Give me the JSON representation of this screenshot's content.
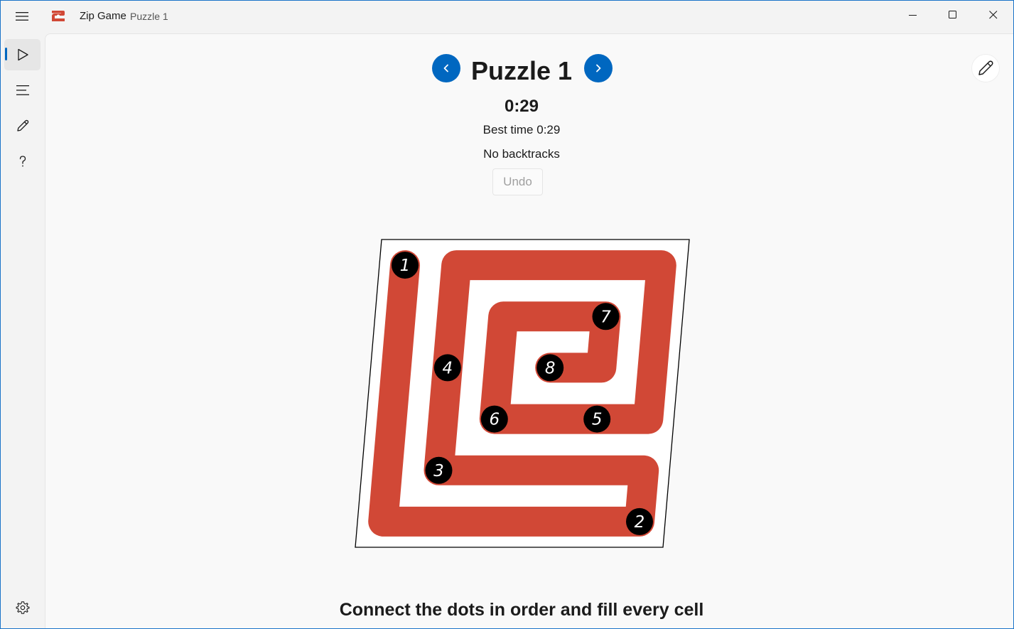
{
  "window": {
    "app_title": "Zip Game",
    "subtitle": "Puzzle 1",
    "controls": [
      "minimize",
      "maximize",
      "close"
    ]
  },
  "sidebar": {
    "items": [
      {
        "icon": "play-icon",
        "active": true
      },
      {
        "icon": "list-icon",
        "active": false
      },
      {
        "icon": "pencil-icon",
        "active": false
      },
      {
        "icon": "help-icon",
        "active": false
      }
    ],
    "footer_icon": "settings-icon"
  },
  "puzzle": {
    "title": "Puzzle 1",
    "timer": "0:29",
    "best_time": "Best time 0:29",
    "backtracks": "No backtracks",
    "undo_label": "Undo",
    "undo_enabled": false
  },
  "board": {
    "rows": 6,
    "cols": 6,
    "path_color": "#d14836",
    "dots": [
      {
        "label": "1",
        "row": 0,
        "col": 0
      },
      {
        "label": "2",
        "row": 5,
        "col": 5
      },
      {
        "label": "3",
        "row": 4,
        "col": 1
      },
      {
        "label": "4",
        "row": 2,
        "col": 1
      },
      {
        "label": "5",
        "row": 3,
        "col": 4
      },
      {
        "label": "6",
        "row": 3,
        "col": 2
      },
      {
        "label": "7",
        "row": 1,
        "col": 4
      },
      {
        "label": "8",
        "row": 2,
        "col": 3
      }
    ],
    "path": [
      [
        0,
        0
      ],
      [
        1,
        0
      ],
      [
        2,
        0
      ],
      [
        3,
        0
      ],
      [
        4,
        0
      ],
      [
        5,
        0
      ],
      [
        5,
        1
      ],
      [
        5,
        2
      ],
      [
        5,
        3
      ],
      [
        5,
        4
      ],
      [
        5,
        5
      ],
      [
        4,
        5
      ],
      [
        4,
        4
      ],
      [
        4,
        3
      ],
      [
        4,
        2
      ],
      [
        4,
        1
      ],
      [
        3,
        1
      ],
      [
        2,
        1
      ],
      [
        1,
        1
      ],
      [
        0,
        1
      ],
      [
        0,
        2
      ],
      [
        0,
        3
      ],
      [
        0,
        4
      ],
      [
        0,
        5
      ],
      [
        1,
        5
      ],
      [
        2,
        5
      ],
      [
        3,
        5
      ],
      [
        3,
        4
      ],
      [
        3,
        3
      ],
      [
        3,
        2
      ],
      [
        2,
        2
      ],
      [
        1,
        2
      ],
      [
        1,
        3
      ],
      [
        1,
        4
      ],
      [
        2,
        4
      ],
      [
        2,
        3
      ]
    ]
  },
  "instructions": "Connect the dots in order and fill every cell",
  "colors": {
    "accent": "#0067c0",
    "path": "#d14836",
    "dot": "#000000"
  }
}
